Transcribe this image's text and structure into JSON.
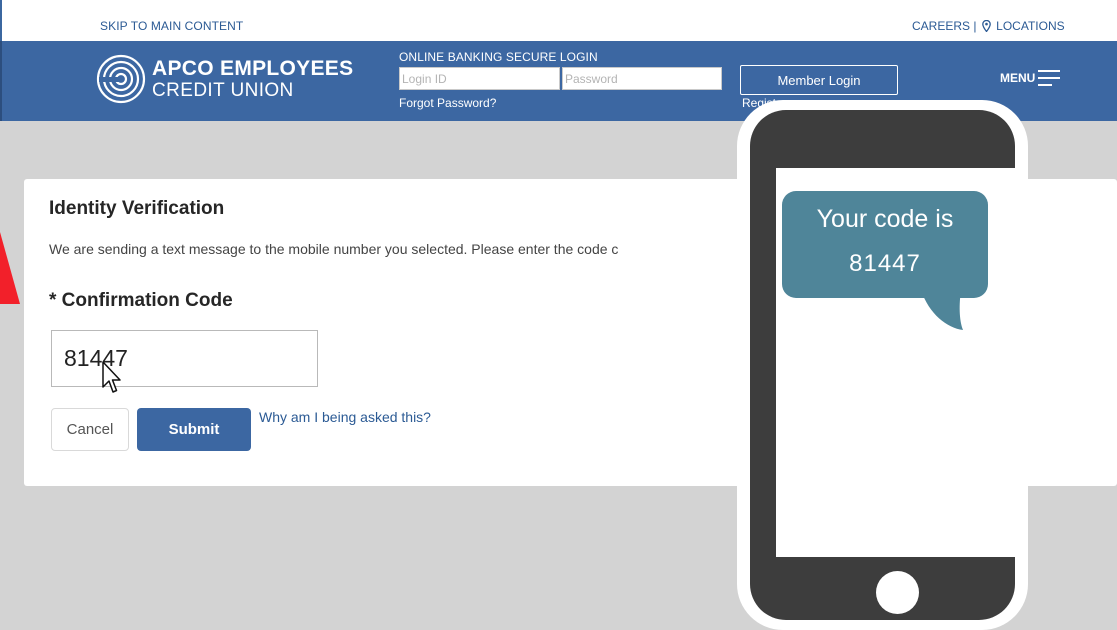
{
  "topbar": {
    "skip_link": "SKIP TO MAIN CONTENT",
    "careers_link": "CAREERS",
    "separator": "|",
    "locations_link": "LOCATIONS",
    "locations_icon": "map-pin-icon"
  },
  "header": {
    "brand_line1": "APCO EMPLOYEES",
    "brand_line2": "CREDIT UNION",
    "logo_icon": "concentric-circles-logo",
    "login_title": "ONLINE BANKING SECURE LOGIN",
    "login_placeholder": "Login ID",
    "password_placeholder": "Password",
    "forgot_link": "Forgot Password?",
    "member_login_button": "Member Login",
    "register_link": "Register",
    "menu_label": "MENU",
    "menu_icon": "hamburger-icon"
  },
  "verification": {
    "title": "Identity Verification",
    "instruction": "We are sending a text message to the mobile number you selected. Please enter the code c",
    "code_label": "* Confirmation Code",
    "code_value": "81447",
    "cancel_button": "Cancel",
    "submit_button": "Submit",
    "why_link": "Why am I being asked this?"
  },
  "phone": {
    "message_line1": "Your code is",
    "message_line2": "81447"
  },
  "colors": {
    "brand_blue": "#3c67a2",
    "bubble_teal": "#4f8599",
    "page_gray": "#d3d3d3",
    "arrow_red": "#f2202a"
  }
}
